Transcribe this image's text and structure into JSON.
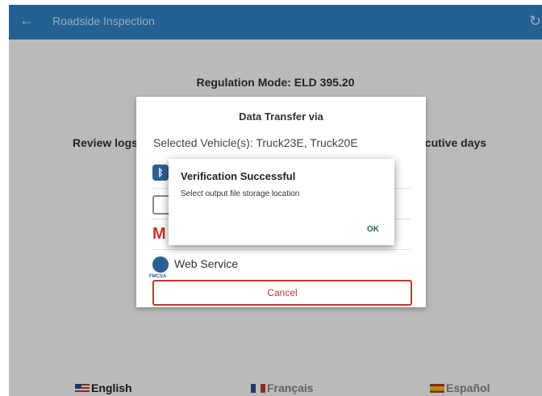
{
  "appbar": {
    "title": "Roadside Inspection",
    "back_icon": "arrow-left-icon",
    "refresh_icon": "refresh-icon",
    "color": "#2f86c8"
  },
  "screen": {
    "regulation": "Regulation Mode: ELD 395.20",
    "review_logs": "Review logs",
    "consecutive_days": "ecutive days"
  },
  "languages": [
    {
      "label": "English",
      "flag": "us-flag-icon"
    },
    {
      "label": "Français",
      "flag": "fr-flag-icon"
    },
    {
      "label": "Español",
      "flag": "es-flag-icon"
    }
  ],
  "data_transfer": {
    "title": "Data Transfer via",
    "selected_vehicles": "Selected Vehicle(s): Truck23E, Truck20E",
    "options": [
      {
        "icon": "bluetooth-icon",
        "label": ""
      },
      {
        "icon": "usb-icon",
        "label": ""
      },
      {
        "icon": "email-icon",
        "label": ""
      },
      {
        "icon": "fmcsa-icon",
        "label": "Web Service",
        "icon_caption": "FMCSA"
      }
    ],
    "cancel": "Cancel"
  },
  "verification": {
    "title": "Verification Successful",
    "message": "Select output file storage location",
    "ok": "OK",
    "ok_color": "#1d6b4a"
  }
}
